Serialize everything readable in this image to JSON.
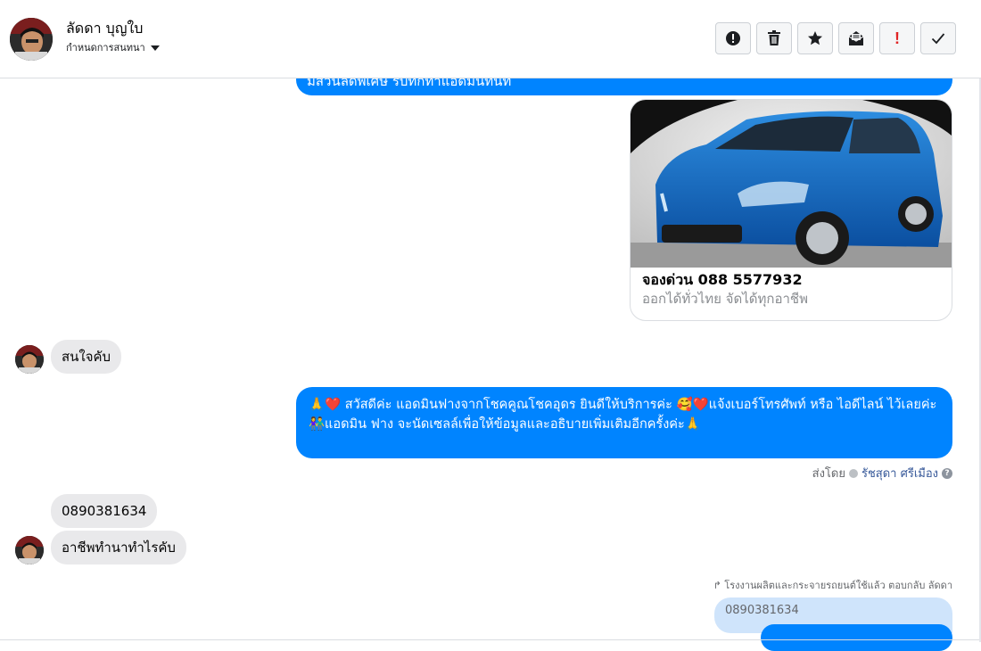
{
  "header": {
    "contact_name": "ลัดดา บุญใบ",
    "subtitle": "กำหนดการสนทนา",
    "toolbar": [
      {
        "icon": "spam-alert-icon"
      },
      {
        "icon": "trash-icon"
      },
      {
        "icon": "star-icon"
      },
      {
        "icon": "mark-unread-icon"
      },
      {
        "icon": "important-icon",
        "text": "!"
      },
      {
        "icon": "done-check-icon"
      }
    ]
  },
  "messages": {
    "top_partial": "มีส่วนลดพิเศษ รับทักทำแอดมินทันที",
    "card_title": "จองด่วน 088 5577932",
    "card_desc": "ออกได้ทั่วไทย จัดได้ทุกอาชีพ",
    "customer_msg_1": "สนใจคับ",
    "agent_line_1": "🙏❤️ สวัสดีค่ะ แอดมินฟางจากโชคคูณโชคอุดร ยินดีให้บริการค่ะ 🥰❤️แจ้งเบอร์โทรศัพท์ หรือ ไอดีไลน์  ไว้เลยค่ะ",
    "agent_line_2": "👫แอดมิน ฟาง จะนัดเซลล์เพื่อให้ข้อมูลและอธิบายเพิ่มเติมอีกครั้งค่ะ🙏",
    "sent_by_label": "ส่งโดย",
    "sent_by_name": "รัชสุดา ศรีเมือง",
    "customer_msg_2": "0890381634",
    "customer_msg_3": "อาชีพทำนาทำไรคับ",
    "reply_note": "โรงงานผลิตและกระจายรถยนต์ใช้แล้ว ตอบกลับ ลัดดา",
    "quoted_text": "0890381634"
  },
  "colors": {
    "accent": "#0084ff",
    "important": "#e02424"
  }
}
